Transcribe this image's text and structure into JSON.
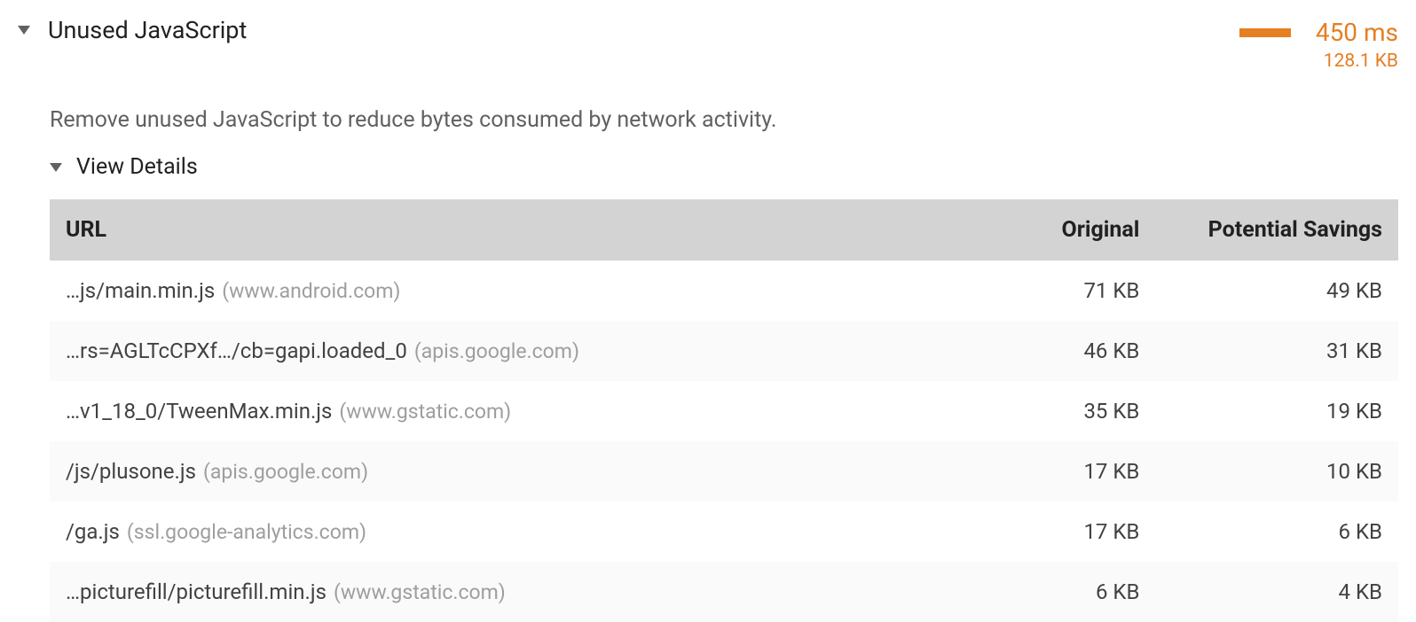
{
  "audit": {
    "title": "Unused JavaScript",
    "description": "Remove unused JavaScript to reduce bytes consumed by network activity.",
    "metric_time": "450 ms",
    "metric_size": "128.1 KB",
    "view_details_label": "View Details"
  },
  "table": {
    "headers": {
      "url": "URL",
      "original": "Original",
      "savings": "Potential Savings"
    },
    "rows": [
      {
        "path": "…js/main.min.js",
        "domain": "(www.android.com)",
        "original": "71 KB",
        "savings": "49 KB"
      },
      {
        "path": "…rs=AGLTcCPXf…/cb=gapi.loaded_0",
        "domain": "(apis.google.com)",
        "original": "46 KB",
        "savings": "31 KB"
      },
      {
        "path": "…v1_18_0/TweenMax.min.js",
        "domain": "(www.gstatic.com)",
        "original": "35 KB",
        "savings": "19 KB"
      },
      {
        "path": "/js/plusone.js",
        "domain": "(apis.google.com)",
        "original": "17 KB",
        "savings": "10 KB"
      },
      {
        "path": "/ga.js",
        "domain": "(ssl.google-analytics.com)",
        "original": "17 KB",
        "savings": "6 KB"
      },
      {
        "path": "…picturefill/picturefill.min.js",
        "domain": "(www.gstatic.com)",
        "original": "6 KB",
        "savings": "4 KB"
      }
    ]
  }
}
